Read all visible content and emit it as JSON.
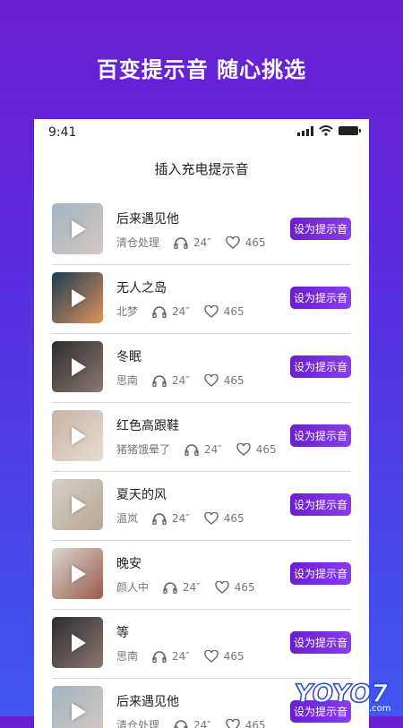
{
  "headline": "百变提示音 随心挑选",
  "status_bar": {
    "time": "9:41"
  },
  "page_title": "插入充电提示音",
  "set_button_label": "设为提示音",
  "songs": [
    {
      "title": "后来遇见他",
      "artist": "清仓处理",
      "plays": "24″",
      "likes": "465",
      "thumb_colors": [
        "#9fb6c4",
        "#d9c7bf"
      ]
    },
    {
      "title": "无人之岛",
      "artist": "北梦",
      "plays": "24″",
      "likes": "465",
      "thumb_colors": [
        "#1a3c55",
        "#e0925a"
      ]
    },
    {
      "title": "冬眠",
      "artist": "思南",
      "plays": "24″",
      "likes": "465",
      "thumb_colors": [
        "#2d2d2d",
        "#8c7770"
      ]
    },
    {
      "title": "红色高跟鞋",
      "artist": "猪猪饿晕了",
      "plays": "24″",
      "likes": "465",
      "thumb_colors": [
        "#c9b3a5",
        "#e7dcd3"
      ]
    },
    {
      "title": "夏天的风",
      "artist": "温岚",
      "plays": "24″",
      "likes": "465",
      "thumb_colors": [
        "#d7cfc6",
        "#b8a895"
      ]
    },
    {
      "title": "晚安",
      "artist": "颜人中",
      "plays": "24″",
      "likes": "465",
      "thumb_colors": [
        "#d9d6d2",
        "#9b5a4b"
      ]
    },
    {
      "title": "等",
      "artist": "思南",
      "plays": "24″",
      "likes": "465",
      "thumb_colors": [
        "#2d2d2d",
        "#8c7770"
      ]
    },
    {
      "title": "后来遇见他",
      "artist": "清仓处理",
      "plays": "24″",
      "likes": "465",
      "thumb_colors": [
        "#9fb6c4",
        "#d9c7bf"
      ]
    }
  ],
  "watermark": {
    "text": "YOYO7",
    "sub": ".com"
  },
  "colors": {
    "accent": "#6a1ed0",
    "accent_light": "#8a3cf0",
    "bg_bottom": "#3f57f0"
  }
}
